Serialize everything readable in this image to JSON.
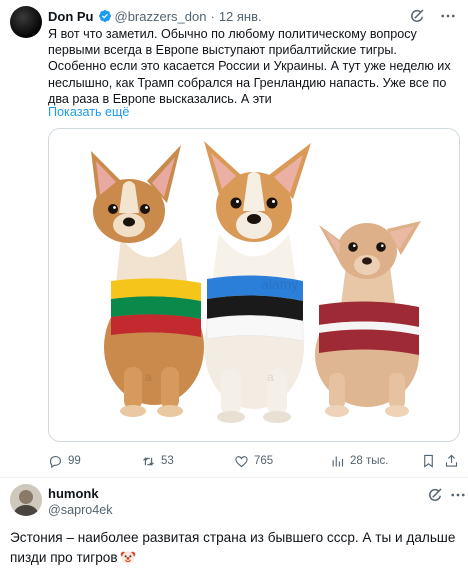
{
  "tweet": {
    "author_name": "Don Pu",
    "handle": "@brazzers_don",
    "date": "12 янв.",
    "text": "Я вот что заметил. Обычно по любому политическому вопросу первыми всегда в Европе выступают прибалтийские тигры. Особенно если это касается России и Украины. А тут уже неделю их неслышно, как Трамп собрался на Гренландию напасть. Уже все по два раза в Европе высказались. А эти",
    "show_more": "Показать ещё",
    "image": {
      "watermarks": [
        "alamy",
        "a",
        "a"
      ],
      "flags": [
        "Lithuania",
        "Estonia",
        "Latvia"
      ]
    },
    "actions": {
      "replies": "99",
      "reposts": "53",
      "likes": "765",
      "views": "28 тыс."
    }
  },
  "reply": {
    "author_name": "humonk",
    "handle": "@sapro4ek",
    "text": "Эстония – наиболее развитая страна из бывшего ссср. А ты и дальше пизди про тигров",
    "emoji": "clown-face-icon"
  },
  "colors": {
    "link": "#1d9bf0",
    "secondary_text": "#536471",
    "verified": "#1d9bf0"
  }
}
